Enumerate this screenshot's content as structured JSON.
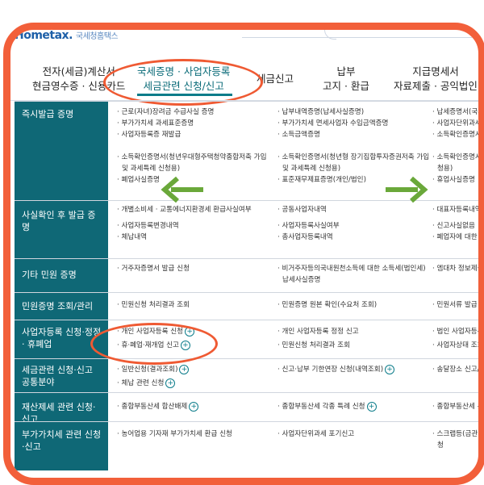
{
  "logo": {
    "text": "Hometax.",
    "sub": "국세청홈택스"
  },
  "nav": [
    {
      "line1": "전자(세금)계산서",
      "line2": "현금영수증 · 신용카드"
    },
    {
      "line1": "국세증명 · 사업자등록",
      "line2": "세금관련 신청/신고"
    },
    {
      "line1": "세금신고",
      "line2": ""
    },
    {
      "line1": "납부",
      "line2": "고지 · 환급"
    },
    {
      "line1": "지급명세서",
      "line2": "자료제출 · 공익법인"
    }
  ],
  "rows": [
    {
      "category": "즉시발급 증명",
      "col1": [
        "· 근로(자녀)장려금 수급사실 증명",
        "· 부가가치세 과세표준증명",
        "· 사업자등록증 재발급",
        "",
        "· 소득확인증명서(청년우대형주택청약종합저축 가입",
        "및 과세특례 신청용)",
        "· 폐업사실증명"
      ],
      "col2": [
        "· 납부내역증명(납세사실증명)",
        "· 부가가치세 면세사업자 수입금액증명",
        "· 소득금액증명",
        "",
        "· 소득확인증명서(청년형 장기집합투자증권저축 가입",
        "및 과세특례 신청용)",
        "· 표준재무제표증명(개인/법인)"
      ],
      "col3": [
        "· 납세증명서(국세",
        "· 사업자단위과세",
        "· 소득확인증명서(",
        "",
        "· 소득확인증명서(",
        "청용)",
        "· 휴업사실증명"
      ]
    },
    {
      "category": "사실확인 후 발급 증명",
      "col1": [
        "· 개별소비세 · 교통에너지환경세 환급사실여부",
        "",
        "· 사업자등록변경내역",
        "· 체납내역"
      ],
      "col2": [
        "· 공동사업자내역",
        "",
        "· 사업자등록사실여부",
        "· 총사업자등록내역"
      ],
      "col3": [
        "· 대표자등록내역",
        "",
        "· 신고사실없음",
        "· 폐업자에 대한 업"
      ]
    },
    {
      "category": "기타 민원 증명",
      "col1": [
        "· 거주자증명서 발급 신청"
      ],
      "col2": [
        "· 비거주자등의국내원천소득에 대한 소득세(법인세)",
        "납세사실증명"
      ],
      "col3": [
        "· 엠대차 정보제공"
      ]
    },
    {
      "category": "민원증명 조회/관리",
      "col1": [
        "· 민원신청 처리결과 조회"
      ],
      "col2": [
        "· 민원증명 원본 확인(수요처 조회)"
      ],
      "col3": [
        "· 민원서류 발급"
      ]
    },
    {
      "category": "사업자등록 신청·정정· 휴폐업",
      "col1": [
        "· 개인 사업자등록 신청",
        "· 휴·폐업·재개업 신고"
      ],
      "col2": [
        "· 개인 사업자등록 정정 신고",
        "· 민원신청 처리결과 조회"
      ],
      "col3": [
        "· 법인 사업자등록",
        "· 사업자상태 조회"
      ]
    },
    {
      "category": "세금관련 신청·신고 공통분야",
      "col1": [
        "· 일반신청(결과조회)",
        "· 체납 관련 신청"
      ],
      "col2": [
        "· 신고·납부 기한연장 신청(내역조회)"
      ],
      "col3": [
        "· 송달장소 신고/변"
      ]
    },
    {
      "category": "재산제세 관련 신청·신고",
      "col1": [
        "· 종합부동산세 합산배제"
      ],
      "col2": [
        "· 종합부동산세 각종 특례 신청"
      ],
      "col3": [
        "· 종합부동산세 분"
      ]
    },
    {
      "category": "부가가치세 관련 신청·신고",
      "col1": [
        "· 농어업용 기자재 부가가치세 환급 신청"
      ],
      "col2": [
        "· 사업자단위과세 포기신고"
      ],
      "col3": [
        "· 스크랩등(금관",
        "청"
      ]
    }
  ],
  "colors": {
    "accent": "#0f6876",
    "highlight": "#f25f3a",
    "arrow": "#6aa83a"
  }
}
